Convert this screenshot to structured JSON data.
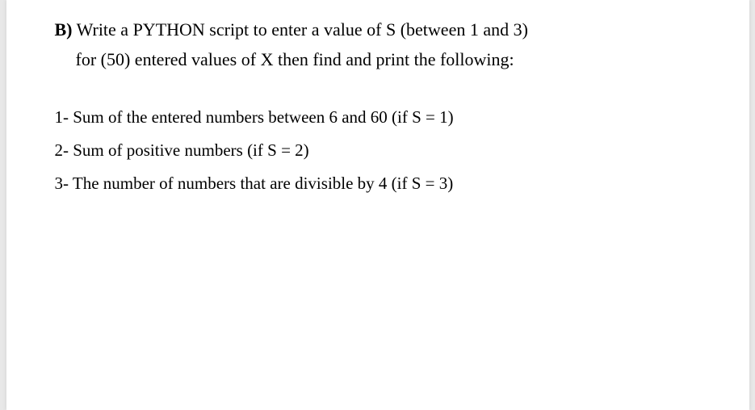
{
  "question": {
    "label": "B)",
    "line1": " Write a PYTHON script to enter a value of S (between 1 and 3)",
    "line2": "for (50) entered values of X then find and print the following:"
  },
  "items": [
    "1- Sum of the entered numbers between 6 and 60 (if S = 1)",
    "2- Sum of positive numbers (if S = 2)",
    "3- The number of numbers that are divisible by 4 (if S = 3)"
  ]
}
